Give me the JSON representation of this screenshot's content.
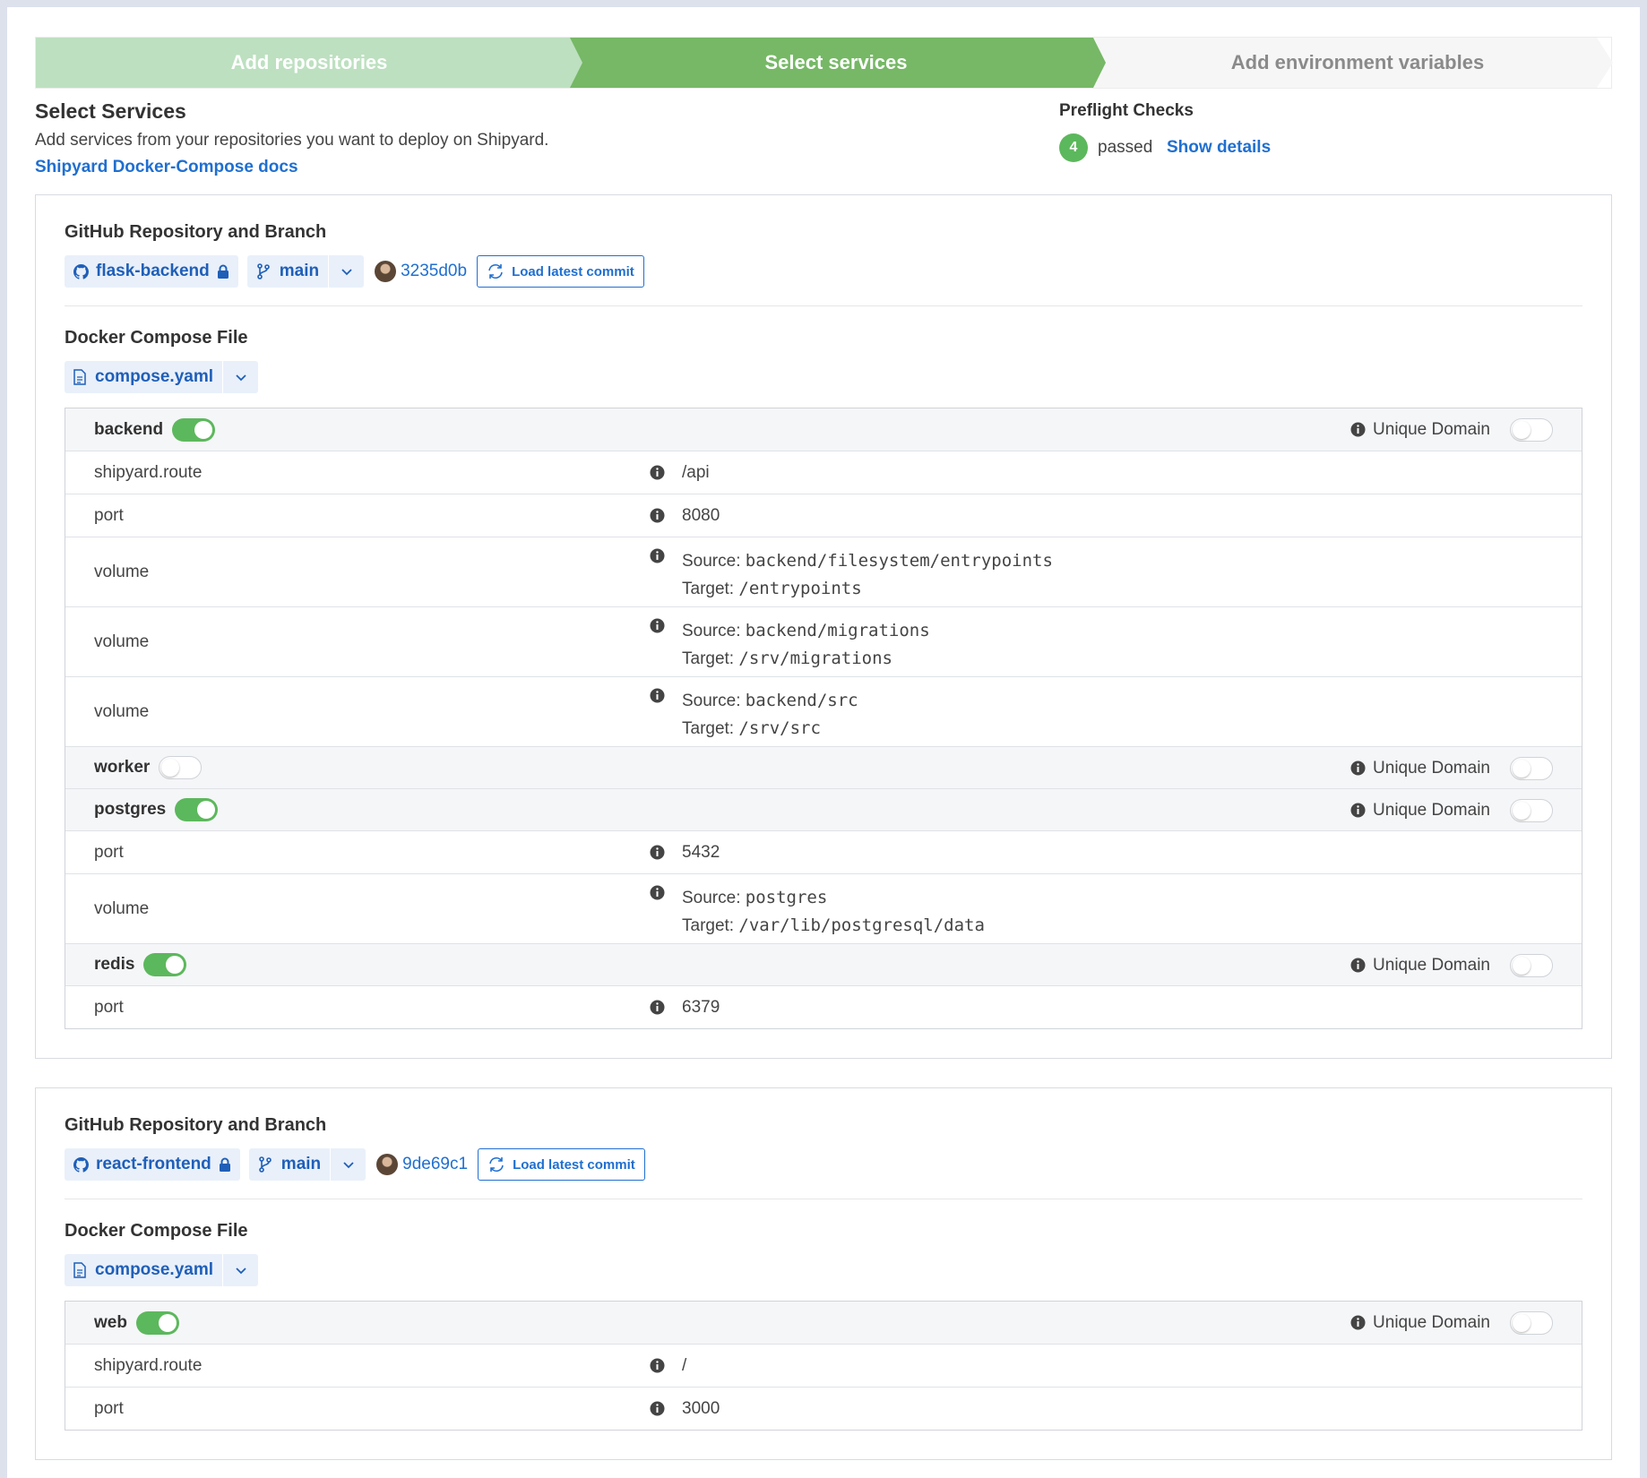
{
  "stepper": {
    "steps": [
      {
        "label": "Add repositories"
      },
      {
        "label": "Select services"
      },
      {
        "label": "Add environment variables"
      }
    ]
  },
  "header": {
    "title": "Select Services",
    "description": "Add services from your repositories you want to deploy on Shipyard.",
    "docs_link": "Shipyard Docker-Compose docs"
  },
  "preflight": {
    "title": "Preflight Checks",
    "count": "4",
    "status": "passed",
    "details_link": "Show details"
  },
  "labels": {
    "repo_section": "GitHub Repository and Branch",
    "compose_section": "Docker Compose File",
    "load_latest": "Load latest commit",
    "unique_domain": "Unique Domain",
    "source": "Source:",
    "target": "Target:"
  },
  "repos": [
    {
      "name": "flask-backend",
      "branch": "main",
      "commit": "3235d0b",
      "compose_file": "compose.yaml",
      "services": [
        {
          "name": "backend",
          "enabled": true,
          "unique_domain": false,
          "attrs": [
            {
              "key": "shipyard.route",
              "value": "/api"
            },
            {
              "key": "port",
              "value": "8080"
            },
            {
              "key": "volume",
              "source": "backend/filesystem/entrypoints",
              "target": "/entrypoints"
            },
            {
              "key": "volume",
              "source": "backend/migrations",
              "target": "/srv/migrations"
            },
            {
              "key": "volume",
              "source": "backend/src",
              "target": "/srv/src"
            }
          ]
        },
        {
          "name": "worker",
          "enabled": false,
          "unique_domain": false,
          "attrs": []
        },
        {
          "name": "postgres",
          "enabled": true,
          "unique_domain": false,
          "attrs": [
            {
              "key": "port",
              "value": "5432"
            },
            {
              "key": "volume",
              "source": "postgres",
              "target": "/var/lib/postgresql/data"
            }
          ]
        },
        {
          "name": "redis",
          "enabled": true,
          "unique_domain": false,
          "attrs": [
            {
              "key": "port",
              "value": "6379"
            }
          ]
        }
      ]
    },
    {
      "name": "react-frontend",
      "branch": "main",
      "commit": "9de69c1",
      "compose_file": "compose.yaml",
      "services": [
        {
          "name": "web",
          "enabled": true,
          "unique_domain": false,
          "attrs": [
            {
              "key": "shipyard.route",
              "value": "/"
            },
            {
              "key": "port",
              "value": "3000"
            }
          ]
        }
      ]
    }
  ],
  "colors": {
    "accent": "#76b866",
    "link": "#1f6fd0",
    "toggle_on": "#5cb85c"
  }
}
